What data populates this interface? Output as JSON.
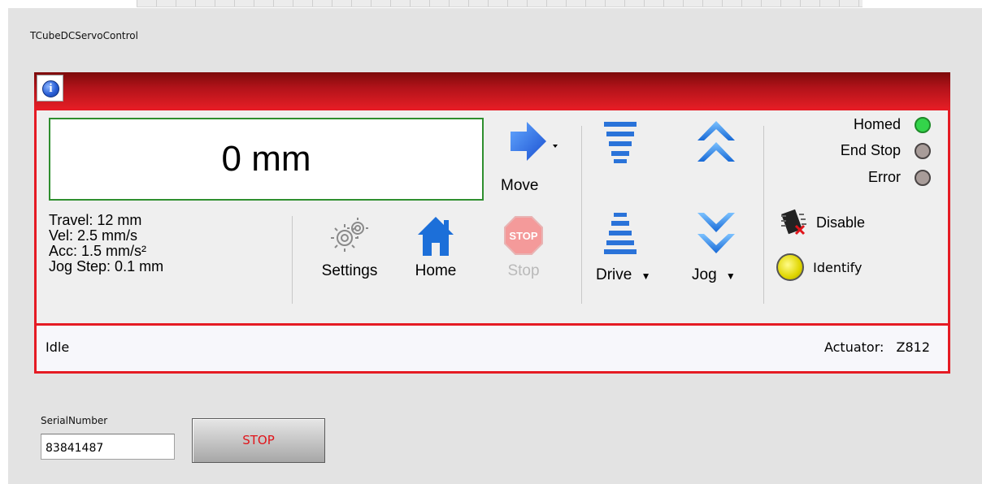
{
  "window": {
    "title": "TCubeDCServoControl"
  },
  "display": {
    "position": "0 mm"
  },
  "params": {
    "travel": "Travel: 12 mm",
    "vel": "Vel: 2.5 mm/s",
    "acc": "Acc: 1.5 mm/s²",
    "jog_step": "Jog Step: 0.1 mm"
  },
  "toolbar": {
    "move": "Move",
    "settings": "Settings",
    "home": "Home",
    "stop": "Stop",
    "stop_icon_text": "STOP",
    "drive": "Drive",
    "jog": "Jog",
    "disable": "Disable",
    "identify": "Identify"
  },
  "indicators": {
    "homed": {
      "label": "Homed",
      "color": "#2ecc40"
    },
    "end_stop": {
      "label": "End Stop",
      "color": "#a89c99"
    },
    "error": {
      "label": "Error",
      "color": "#a89c99"
    }
  },
  "status": {
    "state": "Idle",
    "actuator_label": "Actuator:",
    "actuator_value": "Z812"
  },
  "serial": {
    "label": "SerialNumber",
    "value": "83841487"
  },
  "stop_button": {
    "label": "STOP"
  },
  "colors": {
    "accent_red": "#e51b24",
    "display_border": "#2f8f2f",
    "stop_text": "#e0141a"
  },
  "icons": [
    "info-icon",
    "move-arrow-icon",
    "gear-icon",
    "home-icon",
    "stop-sign-icon",
    "drive-up-icon",
    "drive-down-icon",
    "jog-up-icon",
    "jog-down-icon",
    "disable-chip-icon",
    "identify-led-icon"
  ]
}
